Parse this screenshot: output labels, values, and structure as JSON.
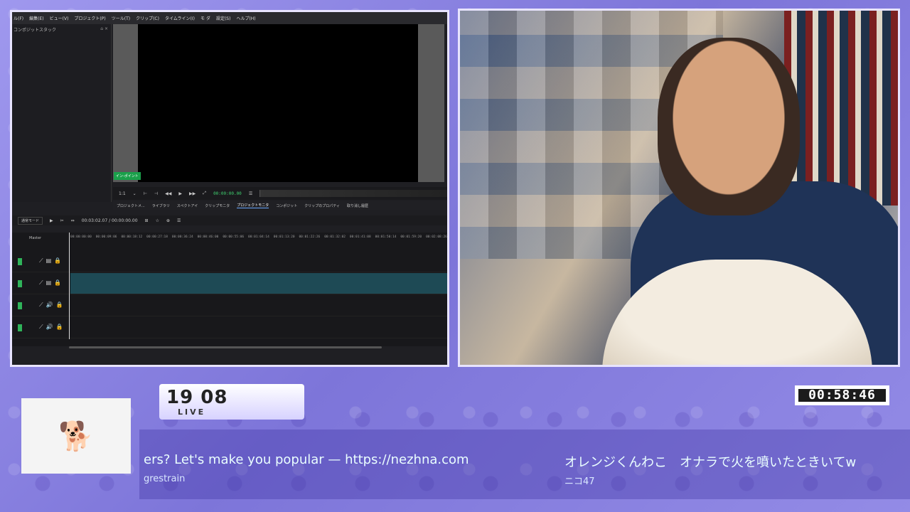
{
  "editor": {
    "menu": [
      "ル(F)",
      "編集(E)",
      "ビュー(V)",
      "プロジェクト(P)",
      "ツール(T)",
      "クリップ(C)",
      "タイムライン(I)",
      "モ ダ",
      "設定(S)",
      "ヘルプ(H)"
    ],
    "left_panel_title": "コンポジットスタック",
    "inpoint_label": "イン-ポイント",
    "zoom_value": "1:1",
    "timecode": "00:00:00.00",
    "tabs": [
      "プロジェクトメ...",
      "ライブラリ",
      "スペクトアイ",
      "クリップモニタ",
      "プロジェクトモニタ",
      "コンポジット",
      "クリップのプロパティ",
      "取り消し履歴"
    ],
    "active_tab": "プロジェクトモニタ",
    "edit_mode": "通常モード",
    "position": "00:03:02.07 / 00:00:00.00",
    "master_label": "Master",
    "ruler_ticks": [
      "00:00:00:00",
      "00:00:09:06",
      "00:00:18:12",
      "00:00:27:18",
      "00:00:36:24",
      "00:00:46:00",
      "00:00:55:06",
      "00:01:04:14",
      "00:01:13:20",
      "00:01:22:26",
      "00:01:32:02",
      "00:01:41:08",
      "00:01:50:14",
      "00:01:59:20",
      "00:02:08:26"
    ]
  },
  "overlay": {
    "clock_time": "19 08",
    "live_label": "LIVE",
    "stream_timer": "00:58:46",
    "ticker_left_message": "ers? Let's make you popular — https://nezhna.com",
    "ticker_left_author": "grestrain",
    "ticker_right_message": "オレンジくんわこ　オナラで火を噴いたときいてw",
    "ticker_right_author": "ニコ47"
  },
  "colors": {
    "background": "#8f88e6",
    "frame_border": "#e8e4ff",
    "timecode_green": "#3fcf6f",
    "selected_track": "#1e4a55"
  }
}
